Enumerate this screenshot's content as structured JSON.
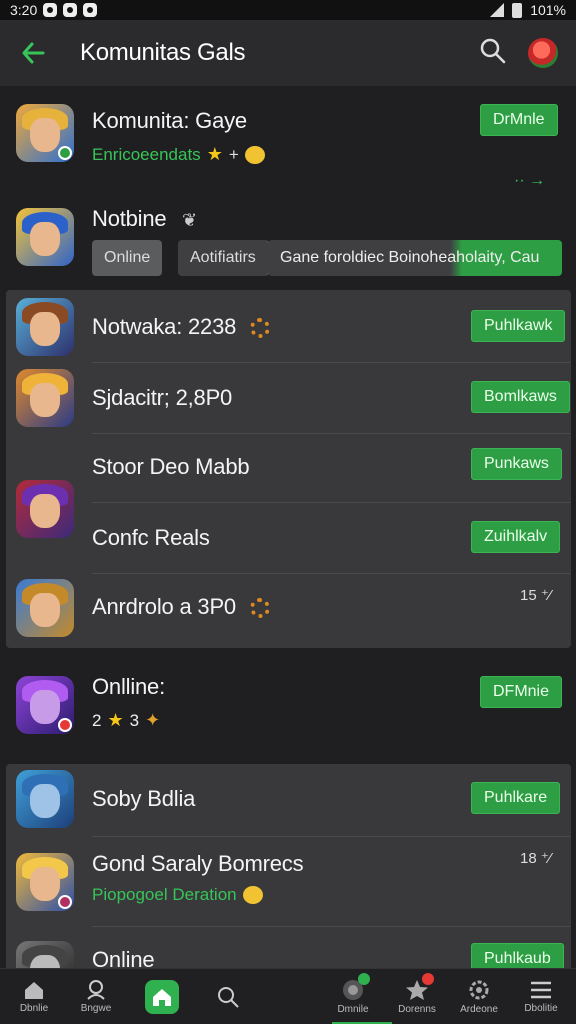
{
  "status_bar": {
    "time": "3:20",
    "battery": "101%"
  },
  "header": {
    "title": "Komunitas Gals"
  },
  "items": [
    {
      "name": "Komunita: Gaye",
      "subtitle": "Enricoeendats",
      "button": "DrMnle"
    },
    {
      "name": "Notbine"
    },
    {
      "name": "Notwaka: 2238",
      "button": "Puhlkawk"
    },
    {
      "name": "Sjdacitr; 2,8P0",
      "button": "Bomlkaws"
    },
    {
      "name": "Stoor Deo Mabb",
      "button": "Punkaws"
    },
    {
      "name": "Confc Reals",
      "button": "Zuihlkalv"
    },
    {
      "name": "Anrdrolo a 3P0",
      "count": "15"
    },
    {
      "name": "Onlline:",
      "subtitle": "2",
      "subtitle_after": "3",
      "button": "DFMnie"
    },
    {
      "name": "Soby Bdlia",
      "button": "Puhlkare"
    },
    {
      "name": "Gond Saraly Bomrecs",
      "subtitle": "Piopogoel Deration",
      "count": "18"
    },
    {
      "name": "Online",
      "button": "Puhlkaub"
    }
  ],
  "filters": {
    "online": "Online",
    "notifications": "Aotifiatirs",
    "description": "Gane foroldiec Boinoheaholaity, Cau"
  },
  "nav": {
    "items": [
      {
        "label": "Dbnlie"
      },
      {
        "label": "Bngwe"
      },
      {
        "label": ""
      },
      {
        "label": ""
      },
      {
        "label": "Dmnile"
      },
      {
        "label": "Dorenns"
      },
      {
        "label": "Ardeone"
      },
      {
        "label": "Dbolitie"
      }
    ]
  },
  "colors": {
    "accent": "#2e9e45",
    "bg": "#1f1f21",
    "card": "#39393c"
  },
  "icons": [
    "back-arrow-icon",
    "search-icon",
    "profile-avatar-icon",
    "home-icon",
    "star-icon",
    "menu-icon"
  ]
}
